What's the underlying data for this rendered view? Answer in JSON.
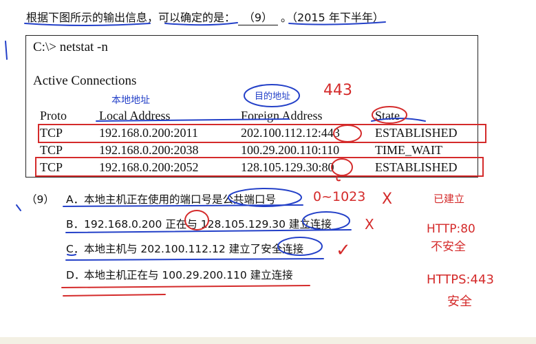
{
  "question": {
    "text": "根据下图所示的输出信息，可以确定的是：",
    "blank": "（9）",
    "suffix": "。（2015 年下半年）"
  },
  "terminal": {
    "command": "C:\\> netstat -n",
    "section_title": "Active Connections",
    "headers": [
      "Proto",
      "Local Address",
      "Foreign Address",
      "State"
    ],
    "rows": [
      [
        "TCP",
        "192.168.0.200:2011",
        "202.100.112.12:443",
        "ESTABLISHED"
      ],
      [
        "TCP",
        "192.168.0.200:2038",
        "100.29.200.110:110",
        "TIME_WAIT"
      ],
      [
        "TCP",
        "192.168.0.200:2052",
        "128.105.129.30:80",
        "ESTABLISHED"
      ]
    ]
  },
  "options": {
    "number": "（9）",
    "items": [
      {
        "letter": "A．",
        "text": "本地主机正在使用的端口号是公共端口号"
      },
      {
        "letter": "B．",
        "text": "192.168.0.200 正在与 128.105.129.30 建立连接"
      },
      {
        "letter": "C．",
        "text": "本地主机与 202.100.112.12 建立了安全连接"
      },
      {
        "letter": "D．",
        "text": "本地主机正在与 100.29.200.110 建立连接"
      }
    ]
  },
  "annotations": {
    "ink_color_blue": "#2340c8",
    "ink_color_red": "#d42a2a",
    "local_note": "本地地址",
    "foreign_note": "目的地址",
    "port_443_note": "443",
    "range_note": "0~1023",
    "wrong_mark_a": "X",
    "wrong_mark_b": "X",
    "right_mark_c": "✓",
    "established_note": "已建立",
    "http_note": "HTTP:80",
    "http_note_2": "不安全",
    "https_note": "HTTPS:443",
    "https_note_2": "安全"
  }
}
